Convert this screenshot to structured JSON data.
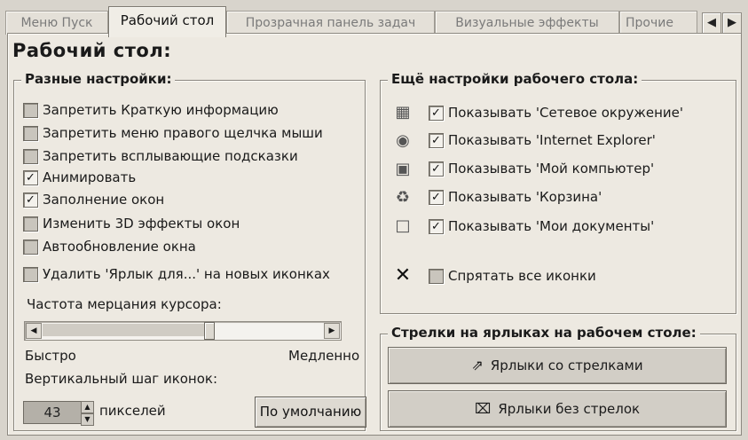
{
  "tabs": [
    {
      "label": "Меню Пуск",
      "active": false
    },
    {
      "label": "Рабочий стол",
      "active": true
    },
    {
      "label": "Прозрачная панель задач",
      "active": false
    },
    {
      "label": "Визуальные эффекты",
      "active": false
    },
    {
      "label": "Прочие",
      "active": false
    }
  ],
  "page_title": "Рабочий стол:",
  "misc": {
    "legend": "Разные настройки:",
    "options": [
      {
        "label": "Запретить Краткую информацию",
        "checked": false
      },
      {
        "label": "Запретить меню правого щелчка мыши",
        "checked": false
      },
      {
        "label": "Запретить всплывающие подсказки",
        "checked": false
      },
      {
        "label": "Анимировать",
        "checked": true
      },
      {
        "label": "Заполнение окон",
        "checked": true
      },
      {
        "label": "Изменить 3D эффекты окон",
        "checked": false
      },
      {
        "label": "Автообновление окна",
        "checked": false
      },
      {
        "label": "Удалить 'Ярлык для...' на новых иконках",
        "checked": false
      }
    ],
    "cursor_blink_label": "Частота мерцания курсора:",
    "cursor_blink_level": 0.6,
    "fast_label": "Быстро",
    "slow_label": "Медленно",
    "icon_spacing_label": "Вертикальный шаг иконок:",
    "icon_spacing_value": "43",
    "units_label": "пикселей",
    "default_button": "По умолчанию"
  },
  "desktop_more": {
    "legend": "Ещё настройки рабочего стола:",
    "options": [
      {
        "label": "Показывать 'Сетевое окружение'",
        "checked": true,
        "icon": "network-icon"
      },
      {
        "label": "Показывать 'Internet Explorer'",
        "checked": true,
        "icon": "internet-explorer-icon"
      },
      {
        "label": "Показывать 'Мой компьютер'",
        "checked": true,
        "icon": "computer-icon"
      },
      {
        "label": "Показывать 'Корзина'",
        "checked": true,
        "icon": "recycle-bin-icon"
      },
      {
        "label": "Показывать 'Мои документы'",
        "checked": true,
        "icon": "documents-icon"
      }
    ],
    "hide_all_label": "Спрятать все иконки",
    "hide_all_checked": false
  },
  "arrows": {
    "legend": "Стрелки на ярлыках на рабочем столе:",
    "with_arrows": "Ярлыки со стрелками",
    "without_arrows": "Ярлыки без стрелок"
  }
}
